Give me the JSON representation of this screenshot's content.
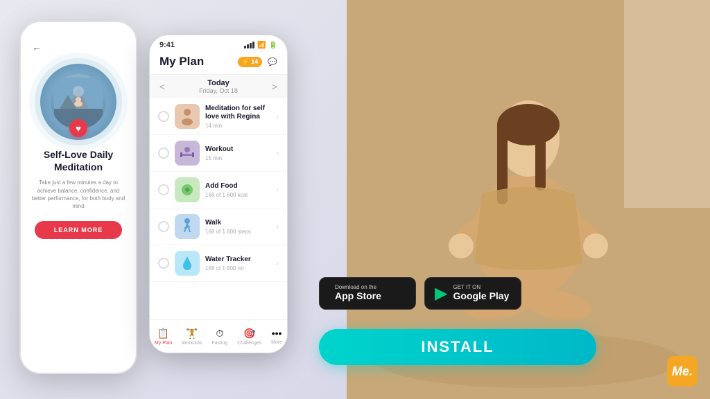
{
  "background": {
    "left_bg": "#e8e8f0",
    "right_bg": "#c8a880"
  },
  "phone_white": {
    "back_arrow": "←",
    "title": "Self-Love Daily\nMeditation",
    "subtitle": "Take just a few minutes a day to achieve balance, confidence, and better performance, for both body and mind",
    "button_label": "LEARN MORE",
    "heart": "♥"
  },
  "phone_dark": {
    "status_time": "9:41",
    "header_title": "My Plan",
    "lightning_label": "⚡ 14",
    "chat_icon": "💬",
    "date_today": "Today",
    "date_sub": "Friday, Oct 18",
    "arrow_left": "<",
    "arrow_right": ">",
    "plan_items": [
      {
        "name": "Meditation for self love with Regina",
        "time": "14 min",
        "color": "#e8c8b0"
      },
      {
        "name": "Workout",
        "time": "15 min",
        "color": "#c8b8d8"
      },
      {
        "name": "Add Food",
        "time": "168 of 1 600 kcal",
        "color": "#c8e8c0"
      },
      {
        "name": "Walk",
        "time": "168 of 1 600 steps",
        "color": "#c0d8f0"
      },
      {
        "name": "Water Tracker",
        "time": "168 of 1 600 ml",
        "color": "#b8e8f8"
      }
    ],
    "nav_items": [
      {
        "label": "My Plan",
        "icon": "📋",
        "active": true
      },
      {
        "label": "Workouts",
        "icon": "🏋",
        "active": false
      },
      {
        "label": "Fasting",
        "icon": "⏱",
        "active": false
      },
      {
        "label": "Challenges",
        "icon": "🎯",
        "active": false
      },
      {
        "label": "More",
        "icon": "⋯",
        "active": false
      }
    ]
  },
  "store_buttons": {
    "apple": {
      "small_text": "Download on the",
      "big_text": "App Store",
      "icon": ""
    },
    "google": {
      "small_text": "GET IT ON",
      "big_text": "Google Play",
      "icon": "▶"
    }
  },
  "install_button": {
    "label": "INSTALL"
  },
  "me_logo": {
    "text": "Me."
  }
}
